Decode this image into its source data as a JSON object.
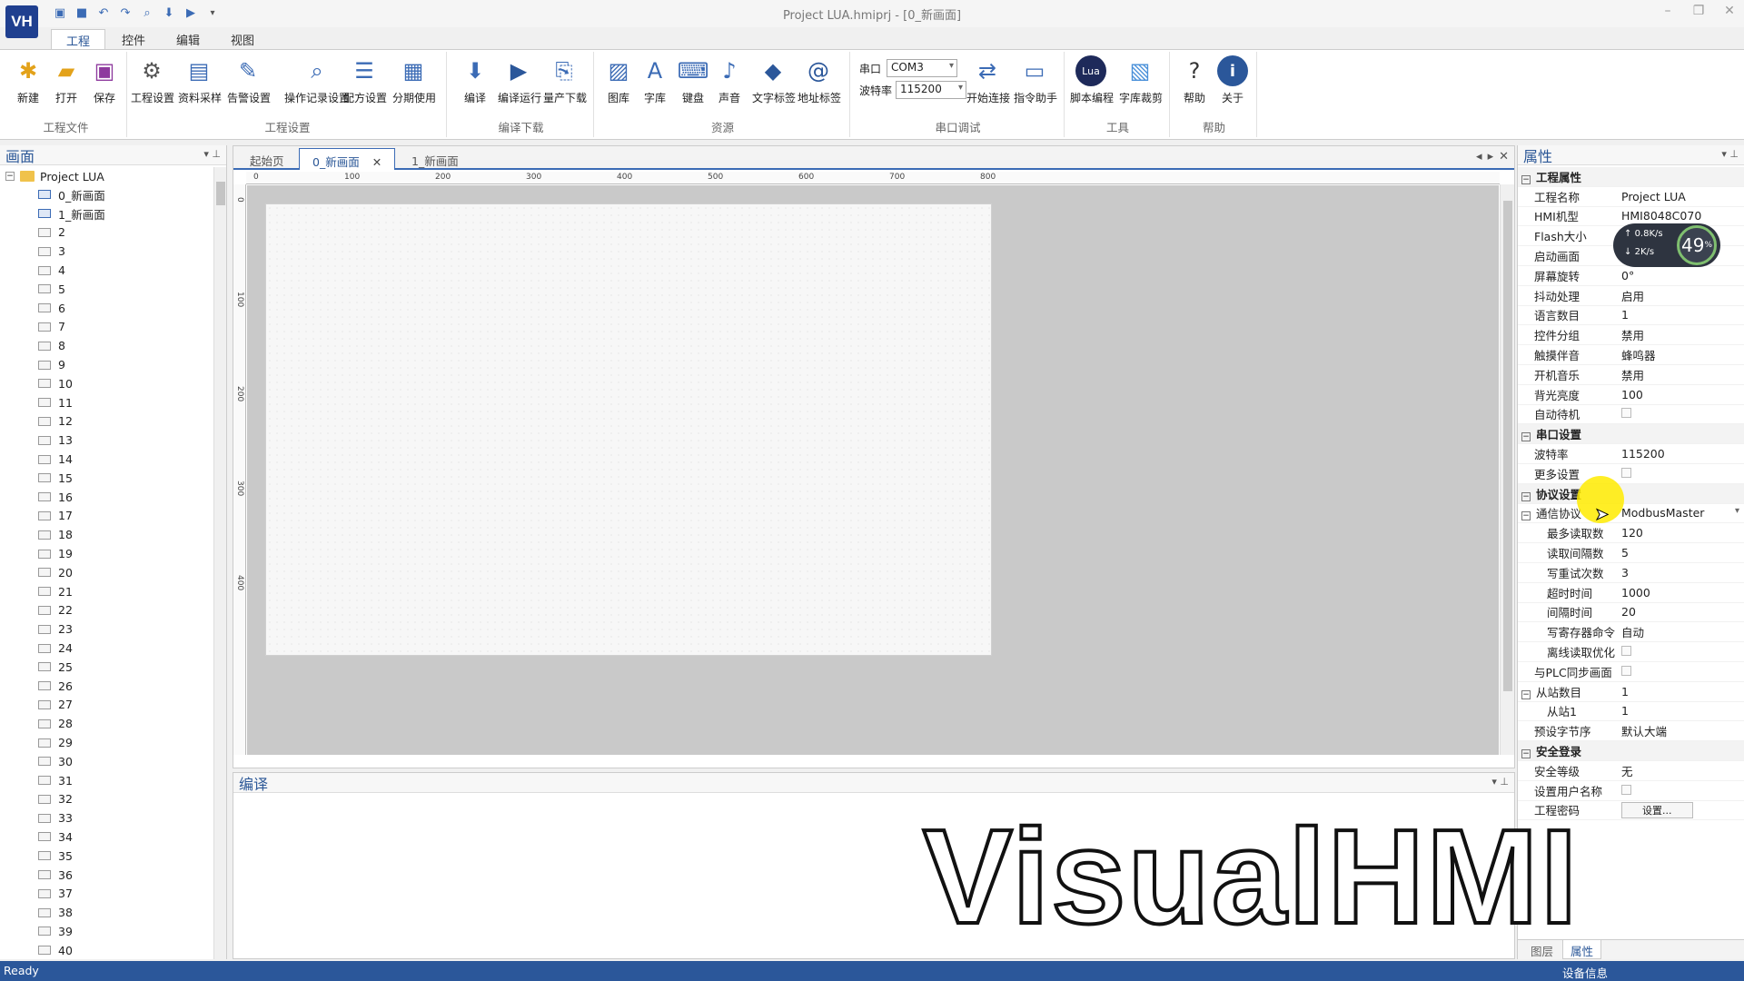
{
  "window": {
    "logo": "VH",
    "title": "Project LUA.hmiprj - [0_新画面]"
  },
  "ribbon_tabs": [
    "工程",
    "控件",
    "编辑",
    "视图"
  ],
  "ribbon": {
    "file_group": {
      "label": "工程文件",
      "buttons": [
        "新建",
        "打开",
        "保存"
      ]
    },
    "settings_group": {
      "label": "工程设置",
      "buttons": [
        "工程设置",
        "资料采样",
        "告警设置",
        "操作记录设置",
        "配方设置",
        "分期使用"
      ]
    },
    "build_group": {
      "label": "编译下载",
      "buttons": [
        "编译",
        "编译运行",
        "量产下载"
      ]
    },
    "resource_group": {
      "label": "资源",
      "buttons": [
        "图库",
        "字库",
        "键盘",
        "声音",
        "文字标签",
        "地址标签"
      ]
    },
    "serial_group": {
      "label": "串口调试",
      "port_label": "串口",
      "port_value": "COM3",
      "baud_label": "波特率",
      "baud_value": "115200",
      "buttons": [
        "开始连接",
        "指令助手"
      ]
    },
    "tools_group": {
      "label": "工具",
      "buttons": [
        "脚本编程",
        "字库裁剪"
      ]
    },
    "help_group": {
      "label": "帮助",
      "buttons": [
        "帮助",
        "关于"
      ]
    }
  },
  "left_panel": {
    "title": "画面",
    "root": "Project LUA",
    "screens": [
      "0_新画面",
      "1_新画面",
      "2",
      "3",
      "4",
      "5",
      "6",
      "7",
      "8",
      "9",
      "10",
      "11",
      "12",
      "13",
      "14",
      "15",
      "16",
      "17",
      "18",
      "19",
      "20",
      "21",
      "22",
      "23",
      "24",
      "25",
      "26",
      "27",
      "28",
      "29",
      "30",
      "31",
      "32",
      "33",
      "34",
      "35",
      "36",
      "37",
      "38",
      "39",
      "40"
    ]
  },
  "doc_tabs": [
    "起始页",
    "0_新画面",
    "1_新画面"
  ],
  "ruler_h": [
    "0",
    "100",
    "200",
    "300",
    "400",
    "500",
    "600",
    "700",
    "800"
  ],
  "ruler_v": [
    "0",
    "100",
    "200",
    "300",
    "400"
  ],
  "compile_panel": {
    "title": "编译"
  },
  "properties": {
    "title": "属性",
    "rows": [
      {
        "type": "section",
        "key": "工程属性"
      },
      {
        "key": "工程名称",
        "value": "Project LUA"
      },
      {
        "key": "HMI机型",
        "value": "HMI8048C070"
      },
      {
        "key": "Flash大小",
        "value": ""
      },
      {
        "key": "启动画面",
        "value": ""
      },
      {
        "key": "屏幕旋转",
        "value": "0°"
      },
      {
        "key": "抖动处理",
        "value": "启用"
      },
      {
        "key": "语言数目",
        "value": "1"
      },
      {
        "key": "控件分组",
        "value": "禁用"
      },
      {
        "key": "触摸伴音",
        "value": "蜂鸣器"
      },
      {
        "key": "开机音乐",
        "value": "禁用"
      },
      {
        "key": "背光亮度",
        "value": "100"
      },
      {
        "key": "自动待机",
        "value": "",
        "checkbox": true
      },
      {
        "type": "section",
        "key": "串口设置"
      },
      {
        "key": "波特率",
        "value": "115200"
      },
      {
        "key": "更多设置",
        "value": "",
        "checkbox": true
      },
      {
        "type": "section",
        "key": "协议设置"
      },
      {
        "key": "通信协议",
        "value": "ModbusMaster",
        "toggle": true
      },
      {
        "key": "最多读取数",
        "value": "120",
        "sub": true
      },
      {
        "key": "读取间隔数",
        "value": "5",
        "sub": true
      },
      {
        "key": "写重试次数",
        "value": "3",
        "sub": true
      },
      {
        "key": "超时时间",
        "value": "1000",
        "sub": true
      },
      {
        "key": "间隔时间",
        "value": "20",
        "sub": true
      },
      {
        "key": "写寄存器命令",
        "value": "自动",
        "sub": true
      },
      {
        "key": "离线读取优化",
        "value": "",
        "sub": true,
        "checkbox": true
      },
      {
        "key": "与PLC同步画面",
        "value": "",
        "checkbox": true
      },
      {
        "key": "从站数目",
        "value": "1",
        "toggle": true
      },
      {
        "key": "从站1",
        "value": "1",
        "sub": true
      },
      {
        "key": "预设字节序",
        "value": "默认大端"
      },
      {
        "type": "section",
        "key": "安全登录"
      },
      {
        "key": "安全等级",
        "value": "无"
      },
      {
        "key": "设置用户名称",
        "value": "",
        "checkbox": true
      },
      {
        "key": "工程密码",
        "value": "设置...",
        "button": true
      }
    ],
    "bottom_tabs": [
      "图层",
      "属性"
    ]
  },
  "net_widget": {
    "up": "0.8",
    "down": "2",
    "unit": "K/s",
    "percent": "49",
    "percent_sign": "%"
  },
  "watermark": "VisualHMI",
  "status": {
    "left": "Ready",
    "right": "设备信息"
  }
}
